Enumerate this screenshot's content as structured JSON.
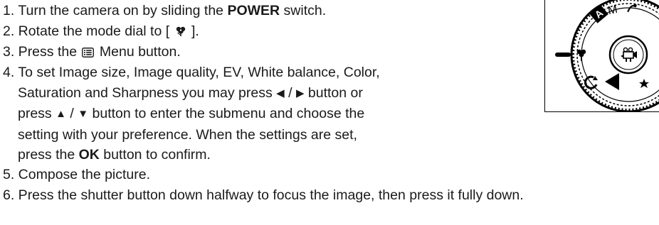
{
  "steps": [
    {
      "num": "1.",
      "pre": " Turn the camera on by sliding the ",
      "bold": "POWER",
      "post": " switch."
    },
    {
      "num": "2.",
      "pre": " Rotate the mode dial to [ ",
      "icon": "macro-icon",
      "post": " ]."
    },
    {
      "num": "3.",
      "pre": " Press the ",
      "icon": "menu-icon",
      "post": " Menu button."
    },
    {
      "num": "4.",
      "line1": " To set Image size, Image quality, EV, White balance, Color,",
      "line2_pre": "Saturation and Sharpness you may press ",
      "line2_sep": " / ",
      "line2_post": " button or",
      "line3_pre": "press ",
      "line3_sep": " / ",
      "line3_post": " button to enter the submenu and choose the",
      "line4": "setting with your preference. When the settings are set,",
      "line5_pre": "press the ",
      "line5_bold": "OK",
      "line5_post": " button to confirm."
    },
    {
      "num": "5.",
      "text": " Compose the picture."
    },
    {
      "num": "6.",
      "text": " Press the shutter button down halfway to focus the image, then press it fully down."
    }
  ],
  "glyphs": {
    "left": "◀",
    "right": "▶",
    "up": "▲",
    "down": "▼",
    "macro": "✿"
  },
  "dial": {
    "mode_letter_a": "A",
    "mode_letter_m": "M",
    "icons": [
      "macro-icon",
      "movie-icon",
      "scene-icon",
      "playback-icon",
      "night-icon"
    ]
  }
}
